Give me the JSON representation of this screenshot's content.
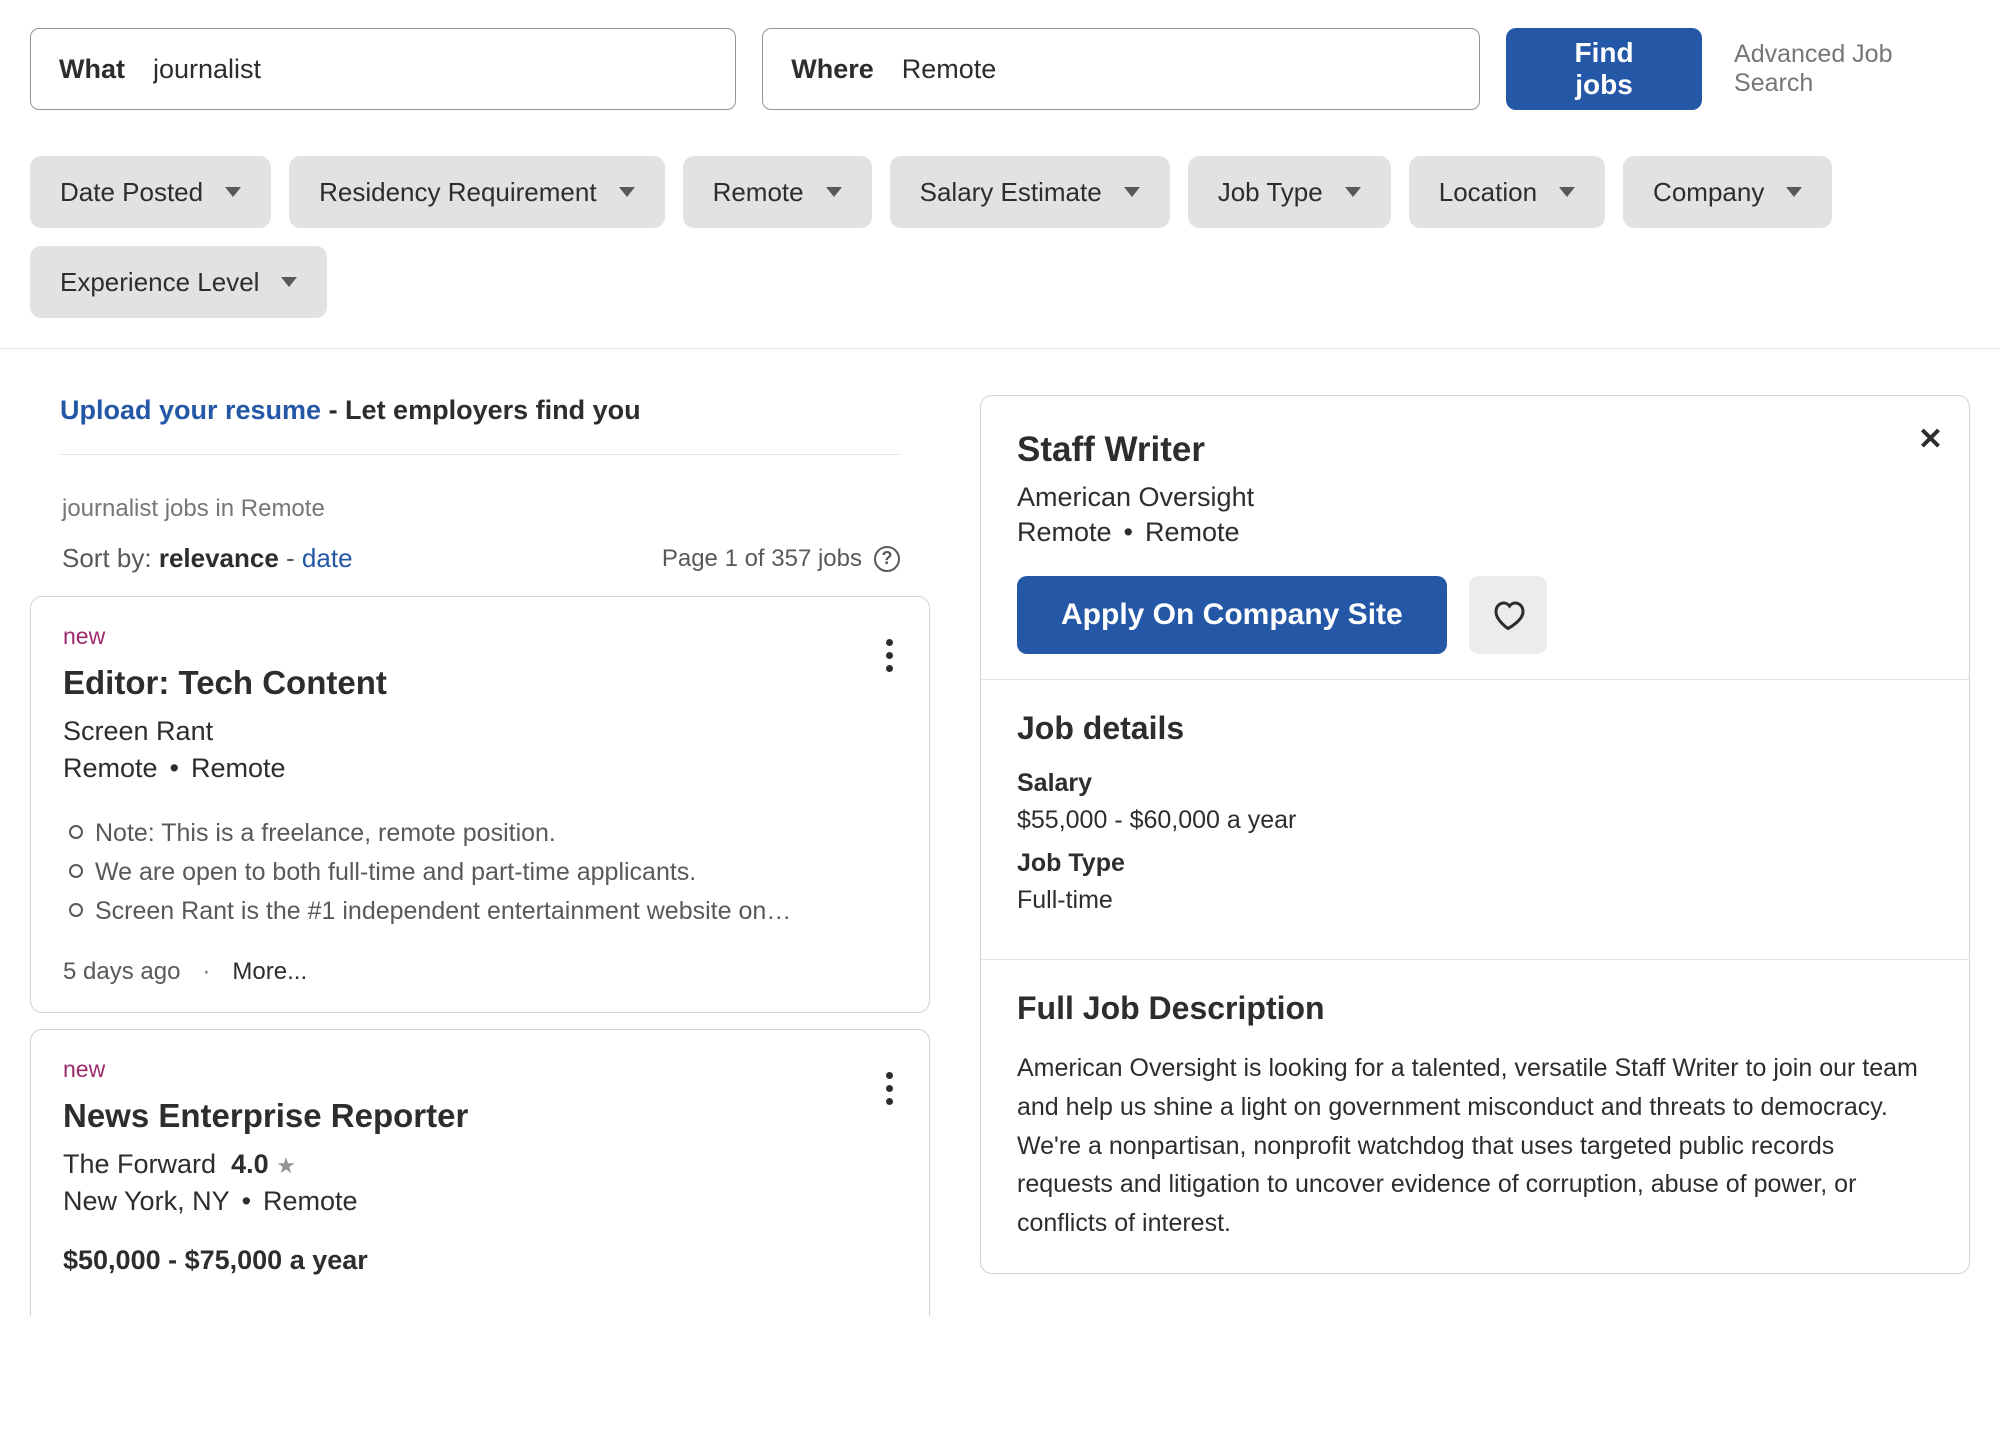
{
  "search": {
    "what_label": "What",
    "what_value": "journalist",
    "where_label": "Where",
    "where_value": "Remote",
    "button": "Find jobs",
    "advanced": "Advanced Job Search"
  },
  "filters": [
    "Date Posted",
    "Residency Requirement",
    "Remote",
    "Salary Estimate",
    "Job Type",
    "Location",
    "Company",
    "Experience Level"
  ],
  "upload": {
    "link": "Upload your resume",
    "rest": " - Let employers find you"
  },
  "query_label": "journalist jobs in Remote",
  "sort": {
    "label": "Sort by: ",
    "active": "relevance",
    "sep": " - ",
    "other": "date"
  },
  "page_info": "Page 1 of 357 jobs",
  "cards": [
    {
      "new": "new",
      "title": "Editor: Tech Content",
      "company": "Screen Rant",
      "loc_a": "Remote",
      "loc_b": "Remote",
      "bullets": [
        "Note: This is a freelance, remote position.",
        "We are open to both full-time and part-time applicants.",
        "Screen Rant is the #1 independent entertainment website on…"
      ],
      "age": "5 days ago",
      "more": "More..."
    },
    {
      "new": "new",
      "title": "News Enterprise Reporter",
      "company": "The Forward",
      "rating": "4.0",
      "loc_a": "New York, NY",
      "loc_b": "Remote",
      "salary": "$50,000 - $75,000 a year"
    }
  ],
  "detail": {
    "title": "Staff Writer",
    "company": "American Oversight",
    "loc_a": "Remote",
    "loc_b": "Remote",
    "apply": "Apply On Company Site",
    "sec1": "Job details",
    "salary_label": "Salary",
    "salary": "$55,000 - $60,000 a year",
    "type_label": "Job Type",
    "type": "Full-time",
    "sec2": "Full Job Description",
    "desc": "American Oversight is looking for a talented, versatile Staff Writer to join our team and help us shine a light on government misconduct and threats to democracy. We're a nonpartisan, nonprofit watchdog that uses targeted public records requests and litigation to uncover evidence of corruption, abuse of power, or conflicts of interest."
  }
}
